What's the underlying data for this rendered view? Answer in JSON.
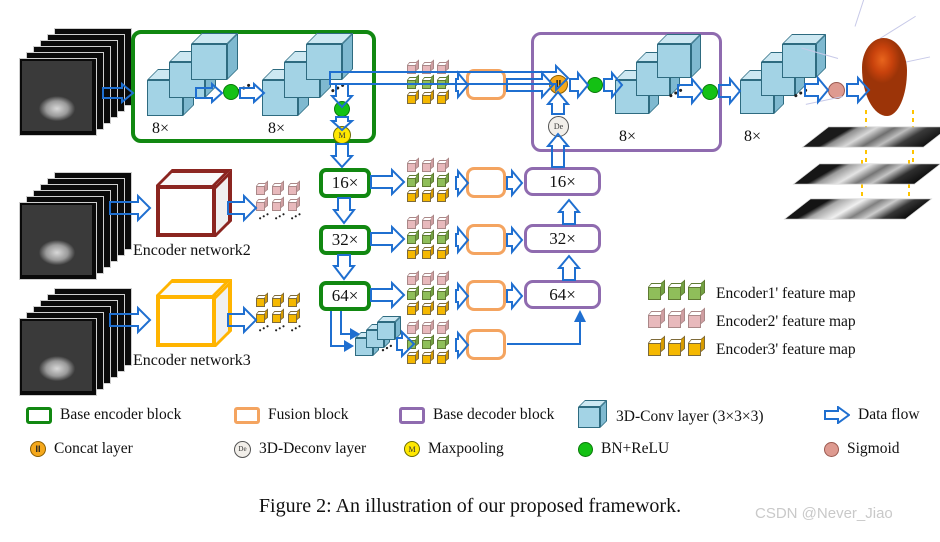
{
  "figure": {
    "caption": "Figure 2: An illustration of our proposed framework.",
    "watermark": "CSDN @Never_Jiao"
  },
  "encoder_labels": {
    "network2": "Encoder network2",
    "network3": "Encoder network3"
  },
  "encoder_top": {
    "stage1_label": "8×",
    "stage2_label": "8×"
  },
  "decoder_top": {
    "stage1_label": "8×",
    "stage2_label": "8×"
  },
  "scale_blocks": {
    "encoder": [
      "16×",
      "32×",
      "64×"
    ],
    "decoder": [
      "16×",
      "32×",
      "64×"
    ]
  },
  "node_labels": {
    "concat": "II",
    "deconv": "De",
    "maxpool": "M"
  },
  "feature_legend": [
    {
      "label": "Encoder1' feature map",
      "color": "#8FBE5A"
    },
    {
      "label": "Encoder2' feature map",
      "color": "#E8B9BC"
    },
    {
      "label": "Encoder3' feature map",
      "color": "#F5B800"
    }
  ],
  "legend": {
    "row1": [
      {
        "name": "base-encoder-block",
        "label": "Base encoder block",
        "icon": "green-square",
        "color": "#118811"
      },
      {
        "name": "fusion-block",
        "label": "Fusion block",
        "icon": "orange-square",
        "color": "#F4A460"
      },
      {
        "name": "base-decoder-block",
        "label": "Base decoder block",
        "icon": "purple-square",
        "color": "#8F6BAF"
      },
      {
        "name": "conv-layer",
        "label": "3D-Conv layer (3×3×3)",
        "icon": "blue-cube",
        "color": "#A3D3E5"
      },
      {
        "name": "data-flow",
        "label": "Data flow",
        "icon": "arrow-right",
        "color": "#1F6FD0"
      }
    ],
    "row2": [
      {
        "name": "concat-layer",
        "label": "Concat layer",
        "icon": "orange-circle",
        "color": "#F5A81C"
      },
      {
        "name": "deconv-layer",
        "label": "3D-Deconv layer",
        "icon": "grey-circle",
        "color": "#F2EFEA"
      },
      {
        "name": "maxpooling",
        "label": "Maxpooling",
        "icon": "yellow-circle",
        "color": "#FFE800"
      },
      {
        "name": "bn-relu",
        "label": "BN+ReLU",
        "icon": "green-circle",
        "color": "#14C114"
      },
      {
        "name": "sigmoid",
        "label": "Sigmoid",
        "icon": "pink-circle",
        "color": "#DE9A90"
      }
    ]
  },
  "colors": {
    "encoder_green": "#118811",
    "fusion_orange": "#F4A460",
    "decoder_purple": "#8F6BAF",
    "conv_cube": "#A3D3E5",
    "arrow_blue": "#1F6FD0",
    "encoder2_box": "#8B2520",
    "encoder3_box": "#FFB400",
    "tumor": "#C8420C"
  }
}
